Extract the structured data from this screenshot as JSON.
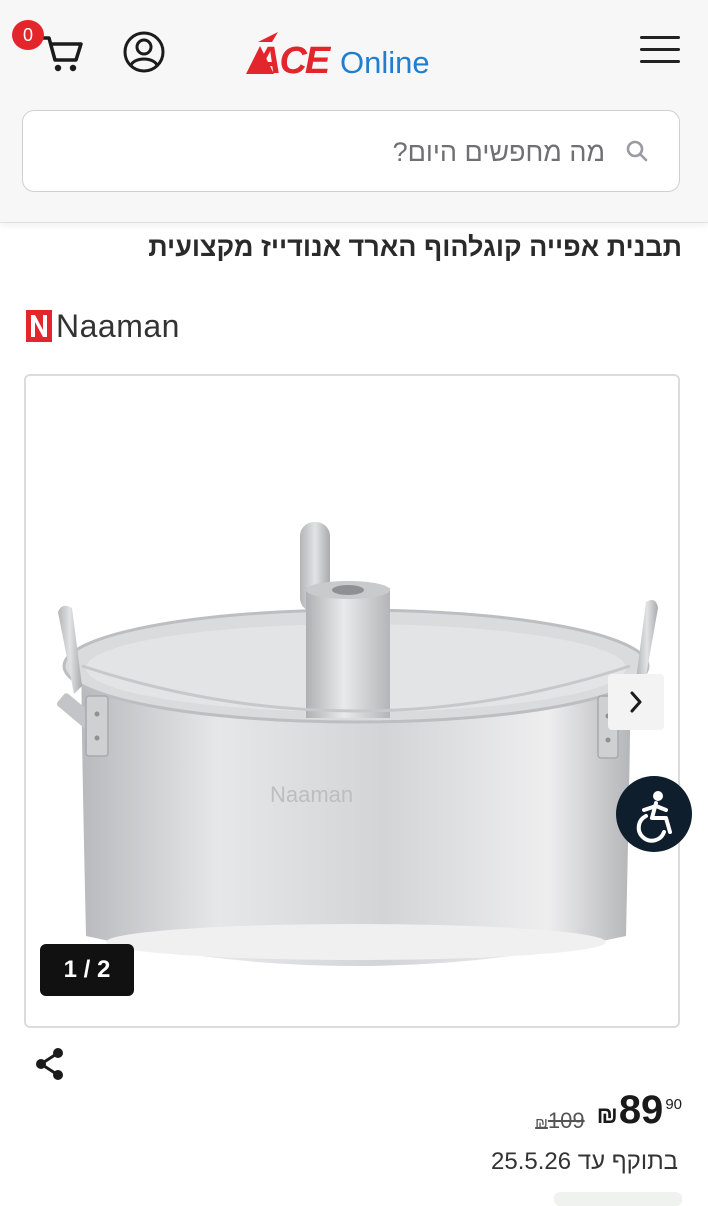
{
  "header": {
    "cart_count": "0",
    "logo": {
      "brand_red": "ACE",
      "brand_blue": "Online",
      "red": "#e3262b",
      "blue": "#1f7ed0"
    },
    "icons": {
      "cart": "cart-icon",
      "user": "user-icon",
      "menu": "hamburger-menu-icon"
    }
  },
  "search": {
    "placeholder": "מה מחפשים היום?",
    "value": "",
    "icon": "search-icon"
  },
  "product": {
    "title": "תבנית אפייה קוגלהוף הארד אנודייז מקצועית",
    "brand": "Naaman",
    "brand_color": "#e3262b",
    "image_counter": "1 / 2",
    "embossed_brand": "Naaman"
  },
  "price": {
    "currency": "₪",
    "current_integer": "89",
    "current_decimal": "90",
    "old": "109",
    "valid_label": "בתוקף עד",
    "valid_date": "25.5.26"
  },
  "actions": {
    "share_icon": "share-icon",
    "next_icon": "chevron-right-icon",
    "accessibility_icon": "accessibility-icon"
  }
}
